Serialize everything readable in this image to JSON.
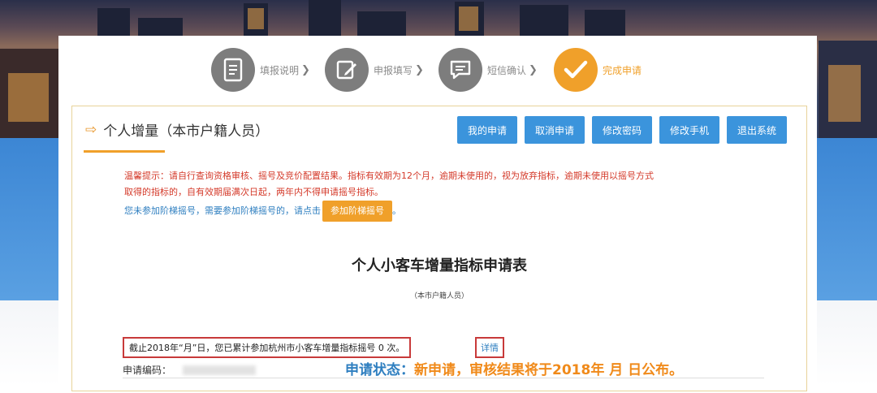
{
  "steps": [
    {
      "label": "填报说明",
      "icon": "document-icon",
      "active": false
    },
    {
      "label": "申报填写",
      "icon": "edit-icon",
      "active": false
    },
    {
      "label": "短信确认",
      "icon": "message-icon",
      "active": false
    },
    {
      "label": "完成申请",
      "icon": "check-icon",
      "active": true
    }
  ],
  "panel": {
    "title": "个人增量（本市户籍人员）",
    "buttons": [
      "我的申请",
      "取消申请",
      "修改密码",
      "修改手机",
      "退出系统"
    ]
  },
  "tips": {
    "line1": "温馨提示：请自行查询资格审核、摇号及竞价配置结果。指标有效期为12个月，逾期未使用的，视为放弃指标，逾期未使用以摇号方式",
    "line2": "取得的指标的，自有效期届满次日起，两年内不得申请摇号指标。",
    "line3": "您未参加阶梯摇号，需要参加阶梯摇号的，请点击",
    "join_button": "参加阶梯摇号",
    "line3_tail": "。"
  },
  "form": {
    "title": "个人小客车增量指标申请表",
    "subtitle": "（本市户籍人员）",
    "notice": "截止2018年“月”日，您已累计参加杭州市小客车增量指标摇号 0 次。",
    "detail_link": "详情",
    "app_no_label": "申请编码：",
    "status_key": "申请状态：",
    "status_value": "新申请，审核结果将于2018年  月  日公布。"
  },
  "colors": {
    "accent": "#f0a02a",
    "button": "#3b94dc",
    "warning": "#d43a2a"
  }
}
